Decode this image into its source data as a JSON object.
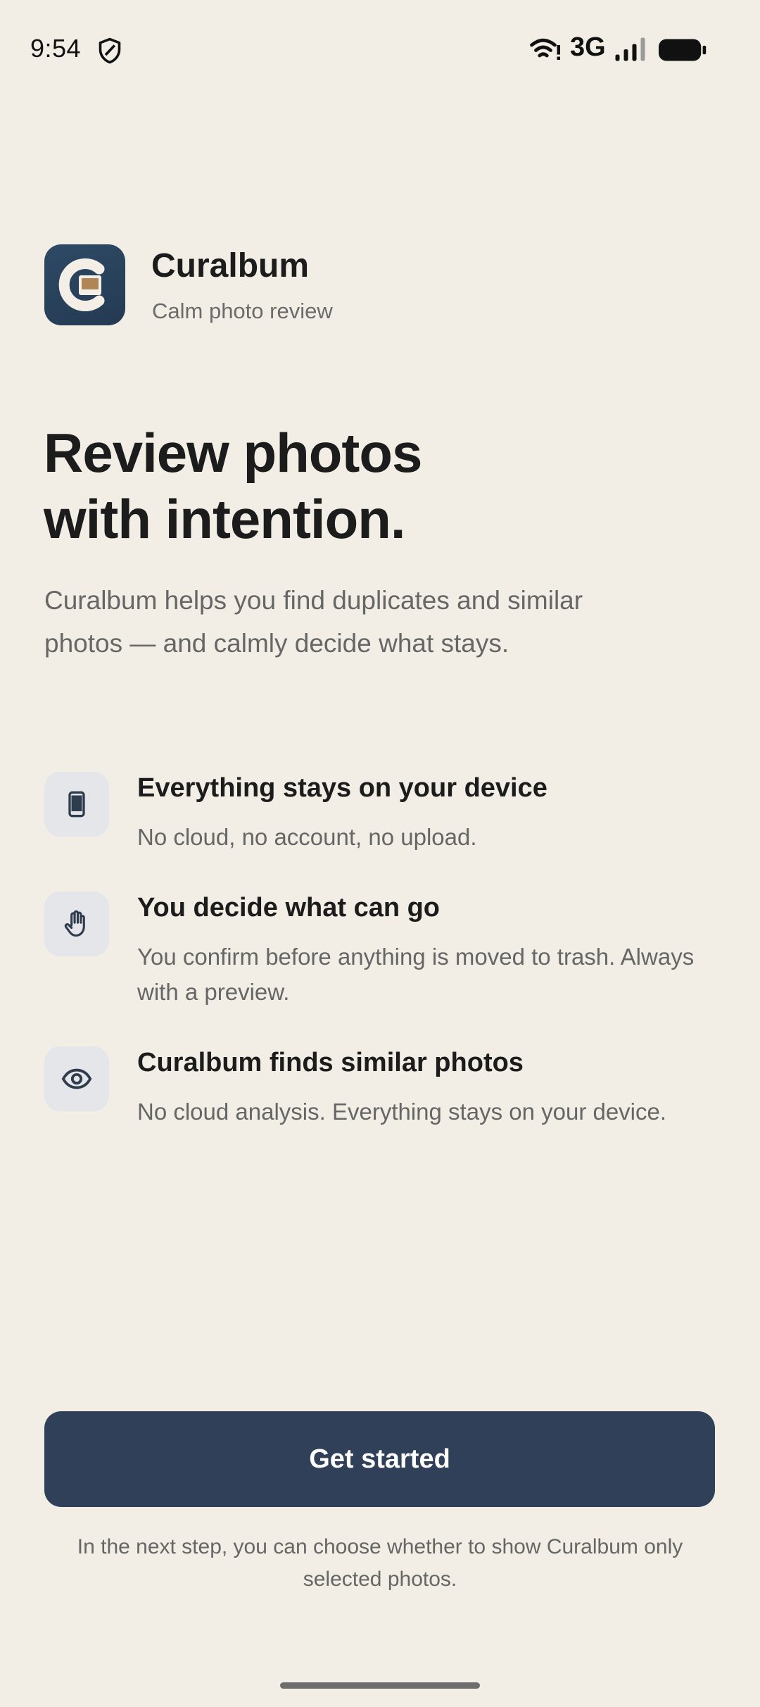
{
  "status_bar": {
    "time": "9:54",
    "network": "3G",
    "icons": [
      "shield-icon",
      "wifi-icon",
      "signal-icon",
      "battery-icon"
    ]
  },
  "app": {
    "name": "Curalbum",
    "tagline": "Calm photo review",
    "logo_icon": "curalbum-logo",
    "colors": {
      "background": "#f2eee5",
      "primary": "#304058",
      "icon_tile": "#e4e6ea"
    }
  },
  "headline": {
    "line1": "Review photos",
    "line2": "with intention."
  },
  "intro": "Curalbum helps you find duplicates and similar photos — and calmly decide what stays.",
  "features": [
    {
      "icon": "phone-icon",
      "title": "Everything stays on your device",
      "description": "No cloud, no account, no upload."
    },
    {
      "icon": "hand-icon",
      "title": "You decide what can go",
      "description": "You confirm before anything is moved to trash. Always with a preview."
    },
    {
      "icon": "eye-icon",
      "title": "Curalbum finds similar photos",
      "description": "No cloud analysis. Everything stays on your device."
    }
  ],
  "cta": {
    "label": "Get started"
  },
  "footnote": "In the next step, you can choose whether to show Curalbum only selected photos."
}
